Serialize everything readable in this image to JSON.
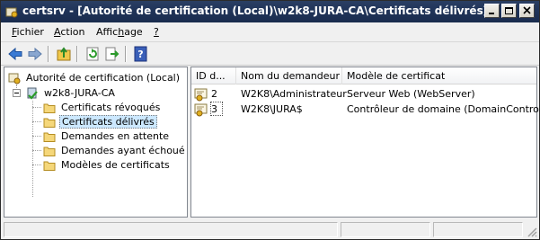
{
  "window": {
    "title": "certsrv - [Autorité de certification (Local)\\w2k8-JURA-CA\\Certificats délivrés]"
  },
  "menu": {
    "items": [
      {
        "label": "Fichier",
        "accesskey": "F"
      },
      {
        "label": "Action",
        "accesskey": "A"
      },
      {
        "label": "Affichage",
        "accesskey": "h"
      },
      {
        "label": "?",
        "accesskey": "?"
      }
    ]
  },
  "toolbar": {
    "icons": [
      "back-icon",
      "forward-icon",
      "up-folder-icon",
      "refresh-icon",
      "export-icon",
      "help-icon"
    ]
  },
  "tree": {
    "root": "Autorité de certification (Local)",
    "ca": "w2k8-JURA-CA",
    "folders": [
      "Certificats révoqués",
      "Certificats délivrés",
      "Demandes en attente",
      "Demandes ayant échoué",
      "Modèles de certificats"
    ],
    "selected_index": 1
  },
  "list": {
    "columns": [
      "ID d...",
      "Nom du demandeur",
      "Modèle de certificat"
    ],
    "rows": [
      {
        "id": "2",
        "requester": "W2K8\\Administrateur",
        "template": "Serveur Web (WebServer)"
      },
      {
        "id": "3",
        "requester": "W2K8\\JURA$",
        "template": "Contrôleur de domaine (DomainController)"
      }
    ]
  },
  "colors": {
    "titlebar": "#203459",
    "selection": "#cce8ff",
    "folder": "#f5d77a"
  }
}
